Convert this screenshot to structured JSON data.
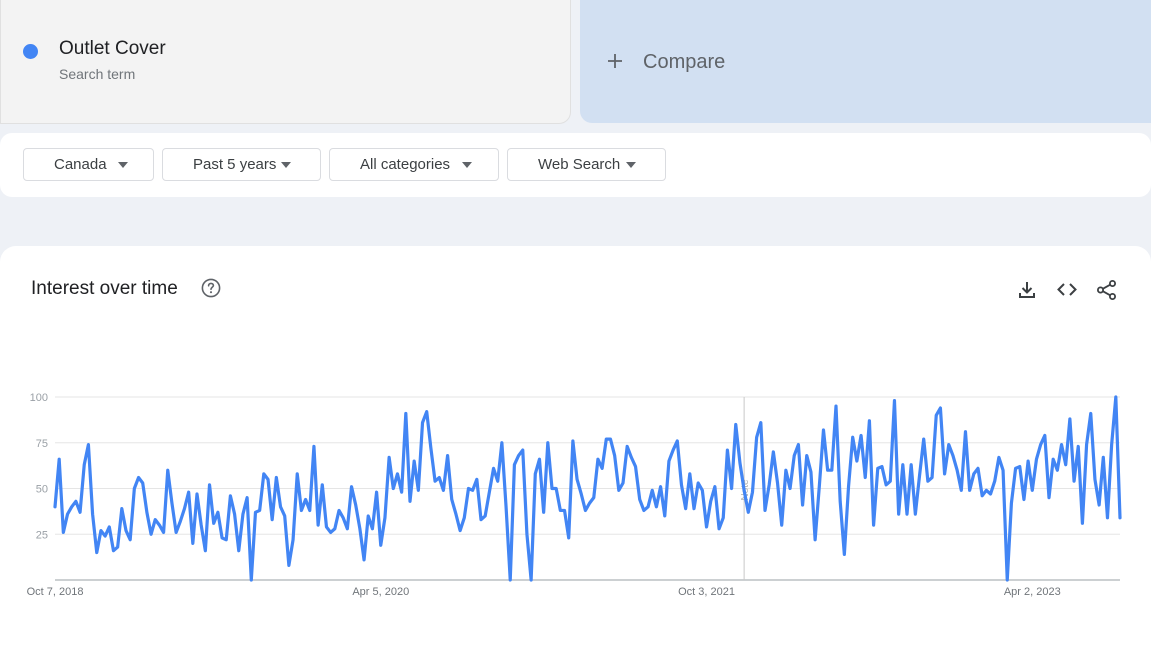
{
  "search_term": {
    "name": "Outlet Cover",
    "subtitle": "Search term",
    "color": "#4285f4"
  },
  "compare": {
    "label": "Compare",
    "icon": "plus-icon"
  },
  "filters": [
    {
      "label": "Canada",
      "icon": "caret-down-icon"
    },
    {
      "label": "Past 5 years",
      "icon": "caret-down-icon"
    },
    {
      "label": "All categories",
      "icon": "caret-down-icon"
    },
    {
      "label": "Web Search",
      "icon": "caret-down-icon"
    }
  ],
  "chart_section": {
    "title": "Interest over time",
    "help_icon": "help-circle-icon",
    "actions": [
      "download-icon",
      "embed-code-icon",
      "share-icon"
    ]
  },
  "chart_data": {
    "type": "line",
    "title": "",
    "xlabel": "",
    "ylabel": "",
    "ylim": [
      0,
      100
    ],
    "yticks": [
      25,
      50,
      75,
      100
    ],
    "grid": true,
    "x_tick_labels": [
      "Oct 7, 2018",
      "Apr 5, 2020",
      "Oct 3, 2021",
      "Apr 2, 2023"
    ],
    "x_tick_indices": [
      0,
      78,
      156,
      234
    ],
    "note": {
      "label": "Note",
      "index": 165
    },
    "line_color": "#4285f4",
    "series": [
      {
        "values": [
          40,
          66,
          26,
          36,
          40,
          43,
          37,
          63,
          74,
          36,
          15,
          27,
          24,
          29,
          16,
          18,
          39,
          27,
          22,
          50,
          56,
          53,
          37,
          25,
          33,
          30,
          26,
          60,
          42,
          26,
          32,
          39,
          48,
          20,
          47,
          30,
          16,
          52,
          31,
          37,
          23,
          22,
          46,
          36,
          16,
          36,
          45,
          0,
          37,
          38,
          58,
          55,
          33,
          56,
          40,
          35,
          8,
          22,
          58,
          38,
          44,
          38,
          73,
          30,
          52,
          29,
          26,
          28,
          38,
          34,
          28,
          51,
          41,
          28,
          11,
          35,
          28,
          48,
          19,
          34,
          67,
          50,
          58,
          48,
          91,
          43,
          65,
          49,
          86,
          92,
          72,
          54,
          56,
          49,
          68,
          44,
          36,
          27,
          34,
          50,
          49,
          55,
          33,
          35,
          48,
          61,
          54,
          75,
          40,
          0,
          63,
          68,
          71,
          25,
          0,
          58,
          66,
          37,
          75,
          50,
          50,
          38,
          38,
          23,
          76,
          55,
          47,
          38,
          42,
          45,
          66,
          61,
          77,
          77,
          68,
          49,
          53,
          73,
          67,
          62,
          44,
          38,
          40,
          49,
          40,
          51,
          35,
          65,
          71,
          76,
          52,
          39,
          58,
          39,
          53,
          49,
          29,
          43,
          51,
          28,
          34,
          71,
          50,
          85,
          64,
          49,
          37,
          48,
          78,
          86,
          38,
          52,
          70,
          53,
          30,
          60,
          50,
          68,
          74,
          41,
          68,
          59,
          22,
          51,
          82,
          60,
          60,
          95,
          43,
          14,
          51,
          78,
          65,
          79,
          56,
          87,
          30,
          61,
          62,
          52,
          54,
          98,
          36,
          63,
          36,
          63,
          36,
          57,
          77,
          54,
          56,
          90,
          94,
          58,
          74,
          68,
          60,
          49,
          81,
          49,
          58,
          61,
          46,
          49,
          47,
          54,
          67,
          60,
          0,
          42,
          61,
          62,
          44,
          65,
          49,
          66,
          74,
          79,
          45,
          66,
          60,
          74,
          63,
          88,
          54,
          73,
          31,
          74,
          91,
          55,
          41,
          67,
          34,
          74,
          100,
          34
        ]
      }
    ]
  }
}
